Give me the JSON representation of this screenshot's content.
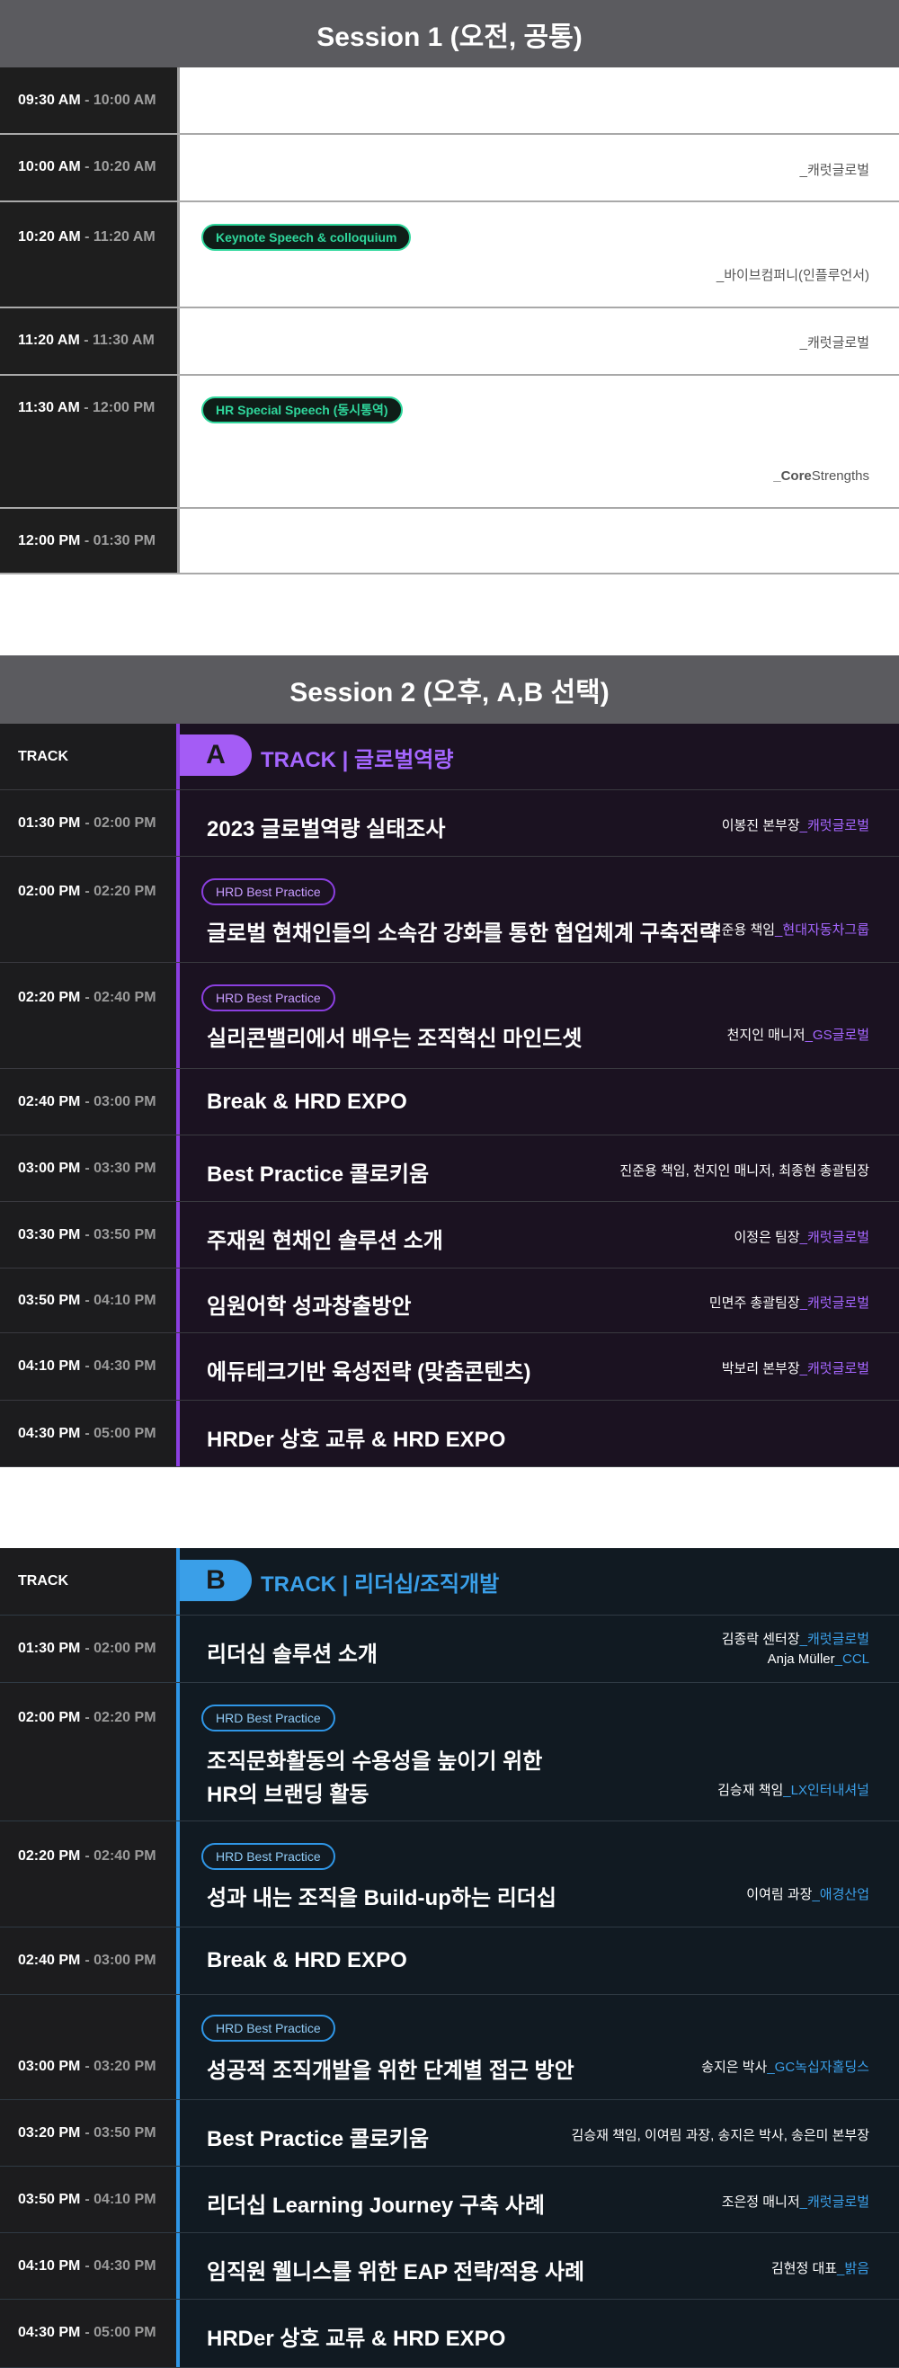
{
  "session1": {
    "title": "Session 1 (오전, 공통)",
    "rows": [
      {
        "start": "09:30 AM",
        "end": "- 10:00 AM",
        "badge": "",
        "speaker": ""
      },
      {
        "start": "10:00 AM",
        "end": "- 10:20 AM",
        "badge": "",
        "speaker": "_캐럿글로벌"
      },
      {
        "start": "10:20 AM",
        "end": "- 11:20 AM",
        "badge": "Keynote Speech & colloquium",
        "speaker": "_바이브컴퍼니(인플루언서)"
      },
      {
        "start": "11:20 AM",
        "end": "- 11:30 AM",
        "badge": "",
        "speaker": "_캐럿글로벌"
      },
      {
        "start": "11:30 AM",
        "end": "- 12:00 PM",
        "badge": "HR Special Speech  (동시통역)",
        "speaker_bold": "_Core",
        "speaker_rest": "Strengths"
      },
      {
        "start": "12:00 PM",
        "end": "- 01:30 PM",
        "badge": "",
        "speaker": ""
      }
    ]
  },
  "session2": {
    "title": "Session 2 (오후, A,B 선택)"
  },
  "trackA": {
    "track_label": "TRACK",
    "letter": "A",
    "name": "TRACK | 글로벌역량",
    "rows": [
      {
        "start": "01:30 PM",
        "end": "- 02:00 PM",
        "title": "2023 글로벌역량 실태조사",
        "speaker": "이봉진 본부장",
        "org": "_캐럿글로벌"
      },
      {
        "start": "02:00 PM",
        "end": "- 02:20 PM",
        "badge": "HRD Best Practice",
        "title": "글로벌 현채인들의 소속감 강화를 통한 협업체계 구축전략",
        "speaker": "진준용 책임",
        "org": "_현대자동차그룹"
      },
      {
        "start": "02:20 PM",
        "end": "- 02:40 PM",
        "badge": "HRD Best Practice",
        "title": "실리콘밸리에서 배우는 조직혁신 마인드셋",
        "speaker": "천지인 매니저",
        "org": "_GS글로벌"
      },
      {
        "start": "02:40 PM",
        "end": "- 03:00 PM",
        "title": "Break & HRD EXPO"
      },
      {
        "start": "03:00 PM",
        "end": "- 03:30 PM",
        "title": "Best Practice 콜로키움",
        "speaker": "진준용 책임, 천지인 매니저, 최종현 총괄팀장"
      },
      {
        "start": "03:30 PM",
        "end": "- 03:50 PM",
        "title": "주재원 현채인 솔루션 소개",
        "speaker": "이정은 팀장",
        "org": "_캐럿글로벌"
      },
      {
        "start": "03:50 PM",
        "end": "- 04:10 PM",
        "title": "임원어학 성과창출방안",
        "speaker": "민면주 총괄팀장",
        "org": "_캐럿글로벌"
      },
      {
        "start": "04:10 PM",
        "end": "- 04:30 PM",
        "title": "에듀테크기반 육성전략 (맞춤콘텐츠)",
        "speaker": "박보리 본부장",
        "org": "_캐럿글로벌"
      },
      {
        "start": "04:30 PM",
        "end": "- 05:00 PM",
        "title": "HRDer 상호 교류 & HRD EXPO"
      }
    ]
  },
  "trackB": {
    "track_label": "TRACK",
    "letter": "B",
    "name": "TRACK | 리더십/조직개발",
    "rows": [
      {
        "start": "01:30 PM",
        "end": "- 02:00 PM",
        "title": "리더십 솔루션 소개",
        "speaker": "김종락 센터장",
        "org": "_캐럿글로벌",
        "speaker2": "Anja Müller",
        "org2": "_CCL"
      },
      {
        "start": "02:00 PM",
        "end": "- 02:20 PM",
        "badge": "HRD Best Practice",
        "title": "조직문화활동의 수용성을 높이기 위한",
        "title2": "HR의 브랜딩 활동",
        "speaker": "김승재 책임",
        "org": "_LX인터내셔널"
      },
      {
        "start": "02:20 PM",
        "end": "- 02:40 PM",
        "badge": "HRD Best Practice",
        "title": "성과 내는 조직을 Build-up하는 리더십",
        "speaker": "이여림 과장",
        "org": "_애경산업"
      },
      {
        "start": "02:40 PM",
        "end": "- 03:00 PM",
        "title": "Break & HRD EXPO"
      },
      {
        "start": "03:00 PM",
        "end": "- 03:20 PM",
        "badge": "HRD Best Practice",
        "title": "성공적 조직개발을 위한 단계별 접근 방안",
        "speaker": "송지은 박사",
        "org": "_GC녹십자홀딩스"
      },
      {
        "start": "03:20 PM",
        "end": "- 03:50 PM",
        "title": "Best Practice 콜로키움",
        "speaker": "김승재 책임, 이여림 과장, 송지은 박사, 송은미 본부장"
      },
      {
        "start": "03:50 PM",
        "end": "- 04:10 PM",
        "title": "리더십 Learning Journey 구축 사례",
        "speaker": "조은정 매니저",
        "org": "_캐럿글로벌"
      },
      {
        "start": "04:10 PM",
        "end": "- 04:30 PM",
        "title": "임직원 웰니스를 위한 EAP 전략/적용 사례",
        "speaker": "김현정 대표",
        "org": "_밝음"
      },
      {
        "start": "04:30 PM",
        "end": "- 05:00 PM",
        "title": "HRDer 상호 교류 & HRD EXPO"
      }
    ]
  }
}
